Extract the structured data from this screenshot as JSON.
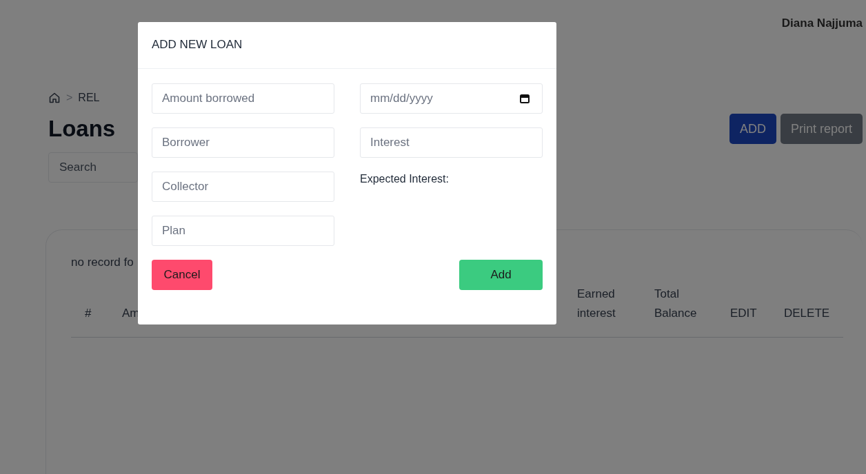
{
  "user": {
    "name": "Diana Najjuma"
  },
  "breadcrumb": {
    "separator": ">",
    "items": [
      "REL"
    ]
  },
  "page_title": "Loans",
  "search": {
    "placeholder": "Search"
  },
  "actions": [
    {
      "label": "ADD",
      "kind": "primary"
    },
    {
      "label": "Print report",
      "kind": "secondary"
    }
  ],
  "table": {
    "message": "no record fo",
    "columns": [
      {
        "label": "#"
      },
      {
        "label": "Am"
      },
      {
        "label": "Earned interest"
      },
      {
        "label": "Total Balance"
      },
      {
        "label": "EDIT"
      },
      {
        "label": "DELETE"
      }
    ]
  },
  "modal": {
    "title": "ADD NEW LOAN",
    "fields_left": [
      {
        "placeholder": "Amount borrowed"
      },
      {
        "placeholder": "Borrower"
      },
      {
        "placeholder": "Collector"
      },
      {
        "placeholder": "Plan"
      }
    ],
    "fields_right": [
      {
        "placeholder": "mm/dd/yyyy",
        "kind": "date"
      },
      {
        "placeholder": "Interest",
        "kind": "text"
      }
    ],
    "expected_interest_label": "Expected Interest:",
    "buttons": [
      {
        "label": "Cancel",
        "kind": "cancel"
      },
      {
        "label": "Add",
        "kind": "submit"
      }
    ]
  }
}
